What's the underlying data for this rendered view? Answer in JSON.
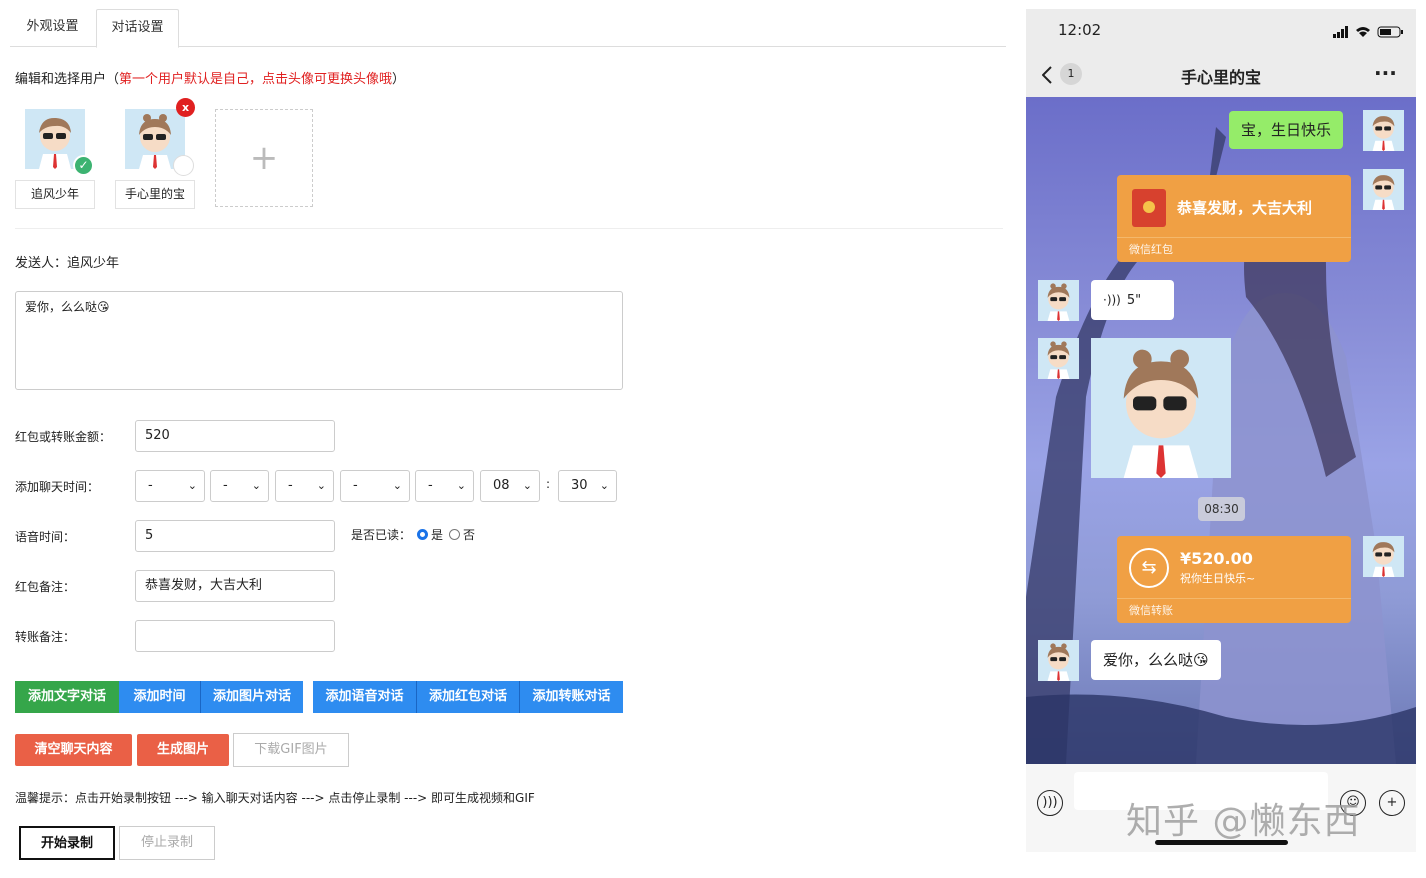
{
  "tabs": [
    "外观设置",
    "对话设置"
  ],
  "section_title": {
    "main": "编辑和选择用户（",
    "red": "第一个用户默认是自己，点击头像可更换头像哦",
    "end": "）"
  },
  "users": [
    {
      "name": "追风少年",
      "selected": true
    },
    {
      "name": "手心里的宝",
      "selected": false
    }
  ],
  "add_user": "+",
  "sender": "发送人：追风少年",
  "message_text": "爱你，么么哒😘",
  "fields": {
    "amount_label": "红包或转账金额：",
    "amount_value": "520",
    "time_label": "添加聊天时间：",
    "time_selects": [
      "-",
      "-",
      "-",
      "-",
      "-",
      "08",
      "30"
    ],
    "time_colon": ":",
    "voice_label": "语音时间：",
    "voice_value": "5",
    "read_label": "是否已读：",
    "read_yes": "是",
    "read_no": "否",
    "read_selected": "是",
    "redpack_label": "红包备注：",
    "redpack_value": "恭喜发财，大吉大利",
    "transfer_label": "转账备注：",
    "transfer_value": ""
  },
  "buttons": {
    "add_text": "添加文字对话",
    "add_time": "添加时间",
    "add_image": "添加图片对话",
    "add_voice": "添加语音对话",
    "add_redpack": "添加红包对话",
    "add_transfer": "添加转账对话",
    "clear": "清空聊天内容",
    "generate": "生成图片",
    "download_gif": "下载GIF图片",
    "start_record": "开始录制",
    "stop_record": "停止录制"
  },
  "tip": "温馨提示：点击开始录制按钮 ---> 输入聊天对话内容 ---> 点击停止录制 ---> 即可生成视频和GIF",
  "phone": {
    "time": "12:02",
    "back_badge": "1",
    "title": "手心里的宝",
    "more": "···",
    "msg1": "宝，生日快乐",
    "redpack_text": "恭喜发财，大吉大利",
    "redpack_footer": "微信红包",
    "voice": "5\"",
    "timestamp": "08:30",
    "transfer_amount": "¥520.00",
    "transfer_note": "祝你生日快乐~",
    "transfer_footer": "微信转账",
    "msg_last": "爱你，么么哒😘"
  },
  "watermark": "知乎 @懒东西",
  "colors": {
    "green_bubble": "#95ec69",
    "orange_card": "#f0a044",
    "blue_btn": "#2e8cf0",
    "green_btn": "#35a64a",
    "orange_btn": "#ea6046",
    "red": "#e02020"
  }
}
